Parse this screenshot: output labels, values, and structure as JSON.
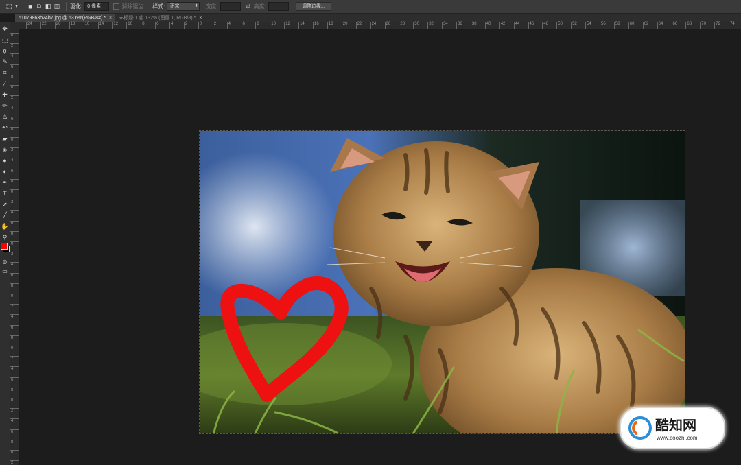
{
  "options_bar": {
    "feather_label": "羽化:",
    "feather_value": "0 像素",
    "antialias_label": "消除锯齿",
    "style_label": "样式:",
    "style_value": "正常",
    "width_label": "宽度:",
    "height_label": "高度:",
    "refine_button": "调整边缘..."
  },
  "tabs": [
    {
      "label": "51079863b24b7.jpg @ 63.6%(RGB/8#) *",
      "active": true
    },
    {
      "label": "未标题-1 @ 132% (图层 1, RGB/8) *",
      "active": false
    }
  ],
  "ruler_top_labels": [
    "24",
    "22",
    "20",
    "18",
    "16",
    "14",
    "12",
    "10",
    "8",
    "6",
    "4",
    "2",
    "0",
    "2",
    "4",
    "6",
    "8",
    "10",
    "12",
    "14",
    "16",
    "18",
    "20",
    "22",
    "24",
    "26",
    "28",
    "30",
    "32",
    "34",
    "36",
    "38",
    "40",
    "42",
    "44",
    "46",
    "48",
    "50",
    "52",
    "54",
    "56",
    "58",
    "60",
    "62",
    "64",
    "66",
    "68",
    "70",
    "72",
    "74"
  ],
  "ruler_left_labels": [
    "0",
    "2",
    "4",
    "6",
    "8",
    "0",
    "2",
    "4",
    "6",
    "8",
    "0",
    "2",
    "4",
    "6",
    "8",
    "0",
    "2",
    "4",
    "6",
    "8",
    "0",
    "2",
    "4",
    "6",
    "8",
    "0",
    "2",
    "4",
    "6",
    "8",
    "0",
    "2",
    "4",
    "6",
    "8",
    "0",
    "2",
    "4",
    "6",
    "8",
    "0",
    "2"
  ],
  "colors": {
    "foreground": "#ff0000",
    "background": "#000000",
    "heart": "#ee1111"
  },
  "toolbar_icons": [
    "move-icon",
    "marquee-icon",
    "lasso-icon",
    "quick-select-icon",
    "crop-icon",
    "eyedropper-icon",
    "healing-brush-icon",
    "brush-icon",
    "clone-stamp-icon",
    "history-brush-icon",
    "eraser-icon",
    "gradient-icon",
    "blur-icon",
    "dodge-icon",
    "pen-icon",
    "type-icon",
    "path-select-icon",
    "line-icon",
    "hand-icon",
    "zoom-icon"
  ],
  "watermark": {
    "brand": "酷知网",
    "url": "www.coozhi.com"
  }
}
